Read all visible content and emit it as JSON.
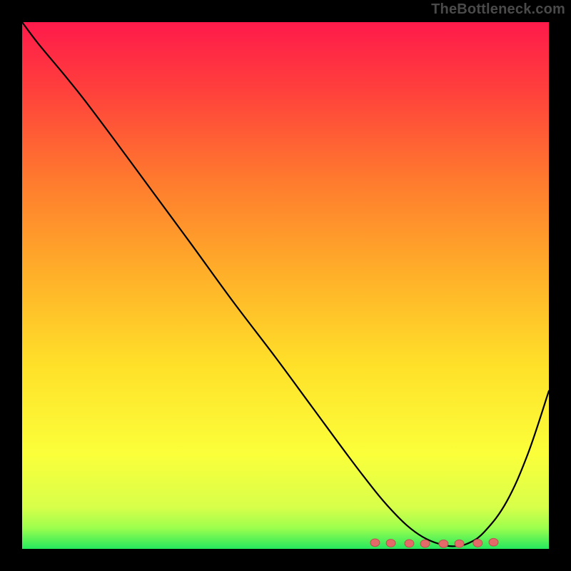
{
  "watermark": "TheBottleneck.com",
  "colors": {
    "background": "#000000",
    "curve": "#000000",
    "marker_fill": "#e46a6a",
    "marker_stroke": "#c14f4f",
    "gradient_top": "#ff1a4b",
    "gradient_bottom": "#26e85e"
  },
  "chart_data": {
    "type": "line",
    "title": "",
    "xlabel": "",
    "ylabel": "",
    "xlim": [
      0,
      100
    ],
    "ylim": [
      0,
      100
    ],
    "x": [
      0,
      3,
      8,
      12,
      18,
      25,
      32,
      40,
      48,
      55,
      62,
      67,
      70,
      73,
      76,
      79,
      82,
      85,
      88,
      92,
      96,
      100
    ],
    "y": [
      100,
      96,
      90,
      85,
      77,
      67.5,
      58,
      47,
      36.5,
      27,
      17.5,
      11,
      7.5,
      4.5,
      2.3,
      1.0,
      0.5,
      1.2,
      3.5,
      9,
      18,
      30
    ],
    "markers_x": [
      67.0,
      70.0,
      73.5,
      76.5,
      80.0,
      83.0,
      86.5,
      89.5
    ],
    "markers_y": [
      0.9,
      0.7,
      0.55,
      0.45,
      0.4,
      0.45,
      0.7,
      1.1
    ],
    "marker_radius_px": 6.5
  }
}
